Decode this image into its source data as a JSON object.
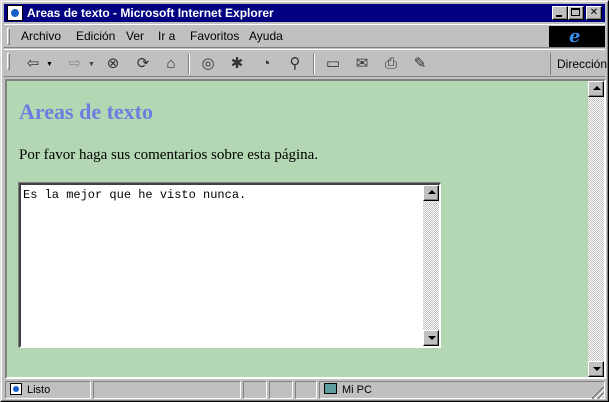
{
  "window": {
    "title": "Areas de texto - Microsoft Internet Explorer"
  },
  "menubar": {
    "items": [
      "Archivo",
      "Edición",
      "Ver",
      "Ir a",
      "Favoritos",
      "Ayuda"
    ]
  },
  "toolbar": {
    "address_label": "Dirección",
    "buttons": [
      "back-icon",
      "forward-icon",
      "stop-icon",
      "refresh-icon",
      "home-icon",
      "search-icon",
      "favorites-icon",
      "history-icon",
      "channels-icon",
      "fullscreen-icon",
      "mail-icon",
      "print-icon",
      "edit-icon"
    ]
  },
  "page": {
    "background_color": "#b2d7b2",
    "heading": "Areas de texto",
    "heading_color": "#6b7fe0",
    "intro": "Por favor haga sus comentarios sobre esta página.",
    "textarea_value": "Es la mejor que he visto nunca."
  },
  "statusbar": {
    "status": "Listo",
    "zone": "Mi PC"
  }
}
